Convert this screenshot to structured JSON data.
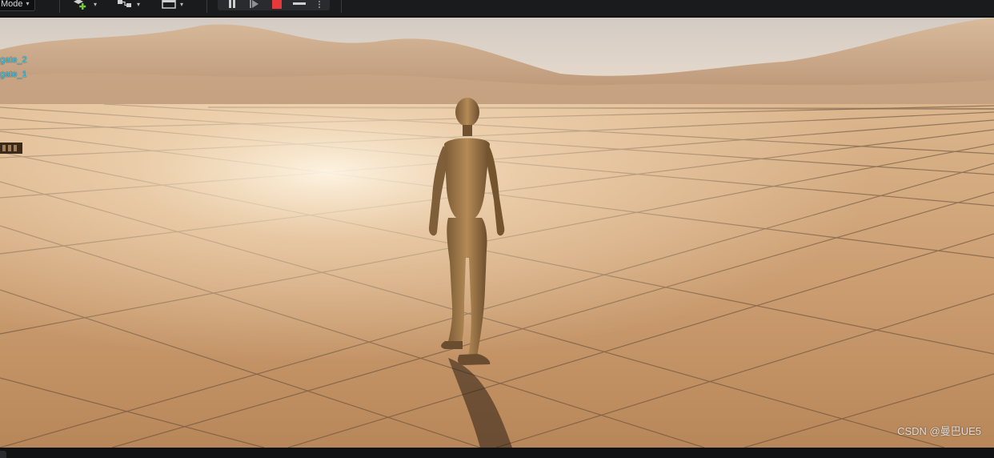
{
  "toolbar": {
    "mode_label": "Mode",
    "buttons": [
      {
        "name": "add-actor",
        "icon": "add-actor-icon"
      },
      {
        "name": "blueprint",
        "icon": "blueprint-icon"
      },
      {
        "name": "cinematics",
        "icon": "cinematics-icon"
      }
    ],
    "play_controls": [
      "pause-icon",
      "skip-frame-icon",
      "stop-icon",
      "eject-icon",
      "more-options-icon"
    ],
    "stop_color": "#e8393a",
    "add_color": "#7cc243"
  },
  "viewport": {
    "actor_labels": [
      "gate_2",
      "gate_1"
    ],
    "label_color": "#2fd4ff",
    "watermark": "CSDN @曼巴UE5"
  }
}
